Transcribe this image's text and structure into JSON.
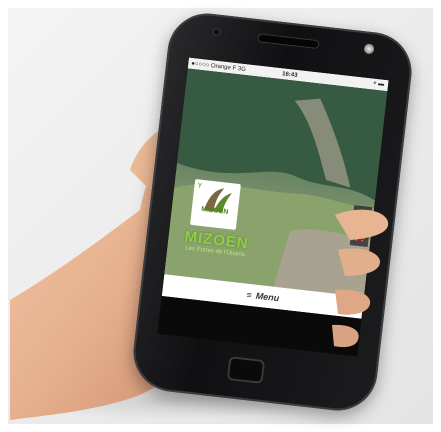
{
  "status_bar": {
    "carrier": "●○○○○ Orange F  3G",
    "time": "16:43",
    "right_icons": "⌖ ▬"
  },
  "site": {
    "logo_text": "MIZOËN",
    "brand_name": "MIZOËN",
    "tagline": "Les Portes de l'Oisans"
  },
  "side_buttons": [
    {
      "icon": "☂"
    },
    {
      "icon": "🚗"
    },
    {
      "icon": "✉"
    }
  ],
  "menu": {
    "icon": "≡",
    "label": "Menu"
  }
}
